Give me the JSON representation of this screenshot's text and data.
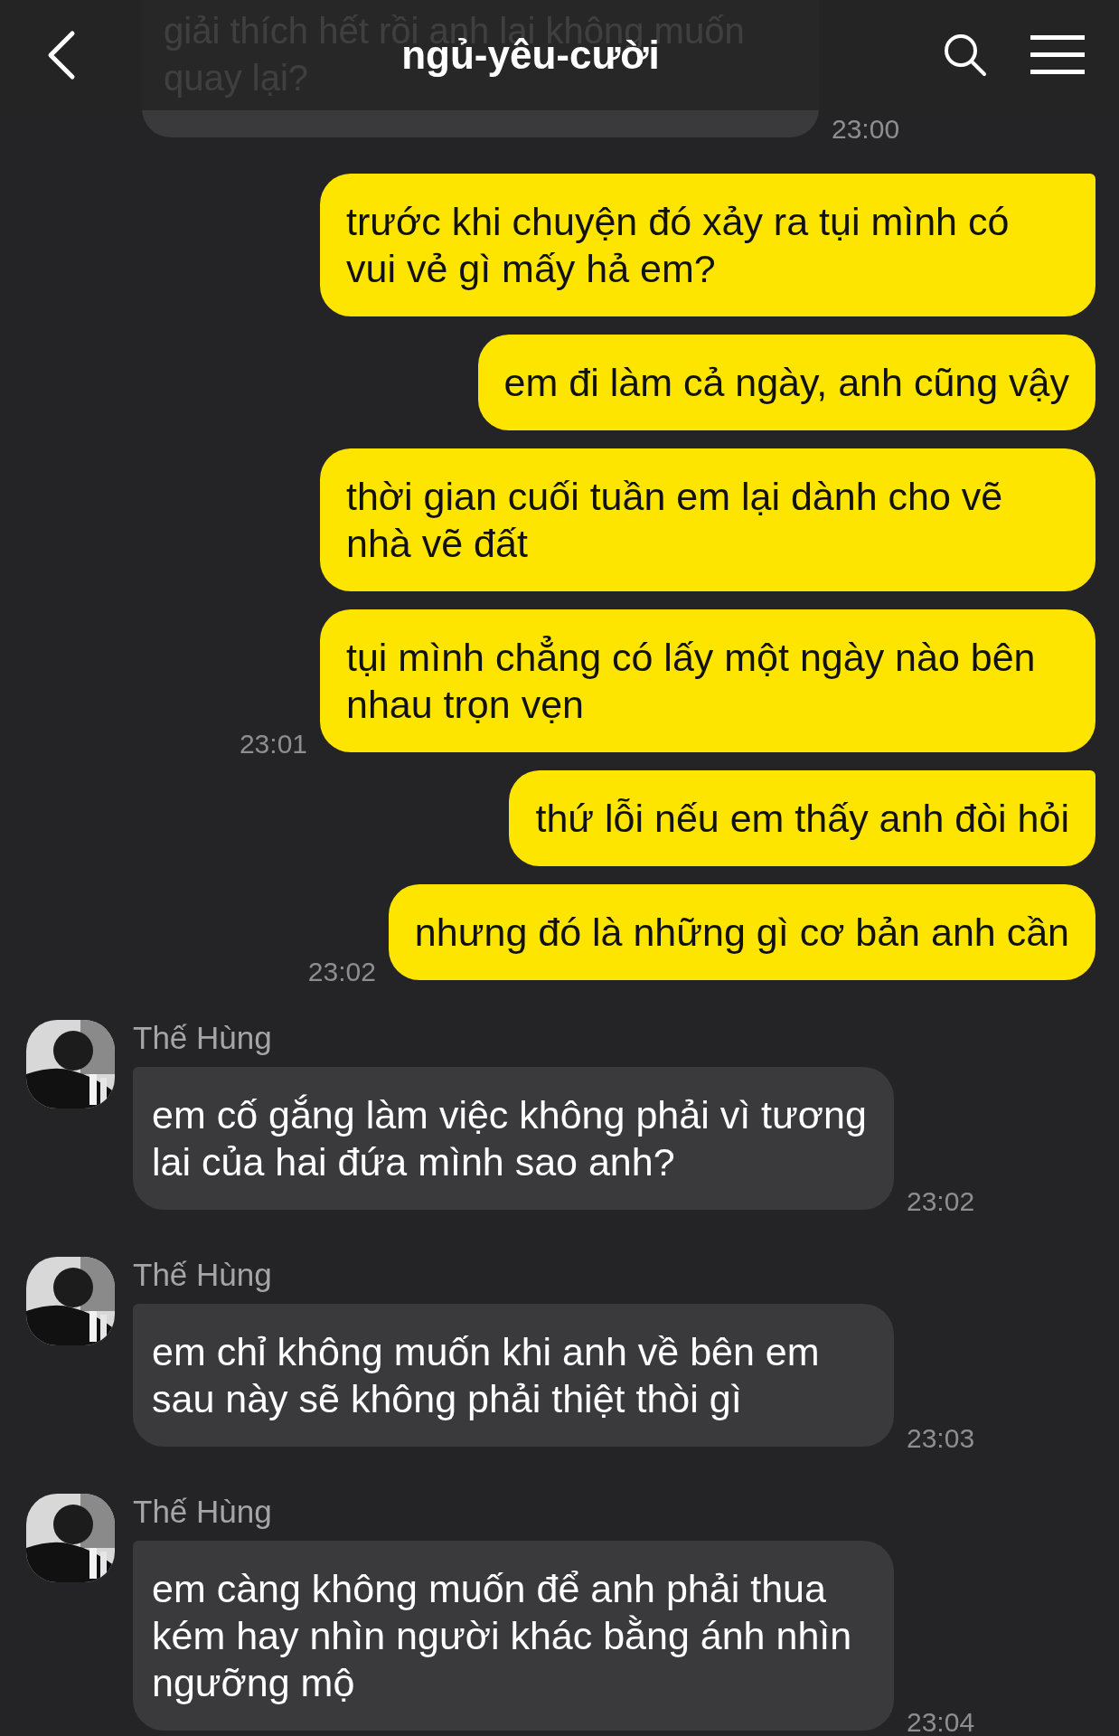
{
  "header": {
    "title": "ngủ-yêu-cười"
  },
  "previous": {
    "text": "giải thích hết rồi anh lại không muốn quay lại?",
    "time": "23:00"
  },
  "messages": [
    {
      "kind": "outgoing",
      "text": "trước khi chuyện đó xảy ra tụi mình có vui vẻ gì mấy hả em?",
      "tail": true
    },
    {
      "kind": "outgoing",
      "text": "em đi làm cả ngày, anh cũng vậy",
      "tail": false
    },
    {
      "kind": "outgoing",
      "text": "thời gian cuối tuần em lại dành cho vẽ nhà vẽ đất",
      "tail": false
    },
    {
      "kind": "outgoing",
      "text": "tụi mình chẳng có lấy một ngày nào bên nhau trọn vẹn",
      "tail": false,
      "time": "23:01"
    },
    {
      "kind": "outgoing",
      "text": "thứ lỗi nếu em thấy anh đòi hỏi",
      "tail": true
    },
    {
      "kind": "outgoing",
      "text": "nhưng đó là những gì cơ bản anh cần",
      "tail": false,
      "time": "23:02"
    },
    {
      "kind": "incoming",
      "sender": "Thế Hùng",
      "text": "em cố gắng làm việc không phải vì tương lai của hai đứa mình sao anh?",
      "time": "23:02"
    },
    {
      "kind": "incoming",
      "sender": "Thế Hùng",
      "text": "em chỉ không muốn khi anh về bên em sau này sẽ không phải thiệt thòi gì",
      "time": "23:03"
    },
    {
      "kind": "incoming",
      "sender": "Thế Hùng",
      "text": "em càng không muốn để anh phải thua kém hay nhìn người khác bằng ánh nhìn ngưỡng mộ",
      "time": "23:04"
    }
  ]
}
